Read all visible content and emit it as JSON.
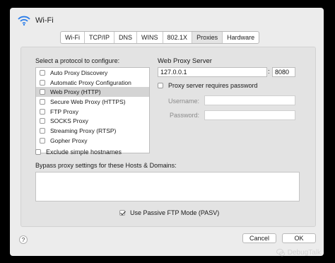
{
  "window": {
    "title": "Wi-Fi"
  },
  "tabs": [
    "Wi-Fi",
    "TCP/IP",
    "DNS",
    "WINS",
    "802.1X",
    "Proxies",
    "Hardware"
  ],
  "protocol_section": {
    "label": "Select a protocol to configure:",
    "items": [
      {
        "label": "Auto Proxy Discovery",
        "checked": false
      },
      {
        "label": "Automatic Proxy Configuration",
        "checked": false
      },
      {
        "label": "Web Proxy (HTTP)",
        "checked": false
      },
      {
        "label": "Secure Web Proxy (HTTPS)",
        "checked": false
      },
      {
        "label": "FTP Proxy",
        "checked": false
      },
      {
        "label": "SOCKS Proxy",
        "checked": false
      },
      {
        "label": "Streaming Proxy (RTSP)",
        "checked": false
      },
      {
        "label": "Gopher Proxy",
        "checked": false
      }
    ],
    "selected_index": 2
  },
  "server": {
    "label": "Web Proxy Server",
    "host": "127.0.0.1",
    "separator": ":",
    "port": "8080",
    "requires_password_label": "Proxy server requires password",
    "requires_password": false,
    "username_label": "Username:",
    "password_label": "Password:"
  },
  "exclude_simple_hostnames": {
    "label": "Exclude simple hostnames",
    "checked": false
  },
  "bypass": {
    "label": "Bypass proxy settings for these Hosts & Domains:",
    "value": ""
  },
  "passive_ftp": {
    "label": "Use Passive FTP Mode (PASV)",
    "checked": true
  },
  "buttons": {
    "help": "?",
    "cancel": "Cancel",
    "ok": "OK"
  },
  "watermark": "DebugTalk"
}
